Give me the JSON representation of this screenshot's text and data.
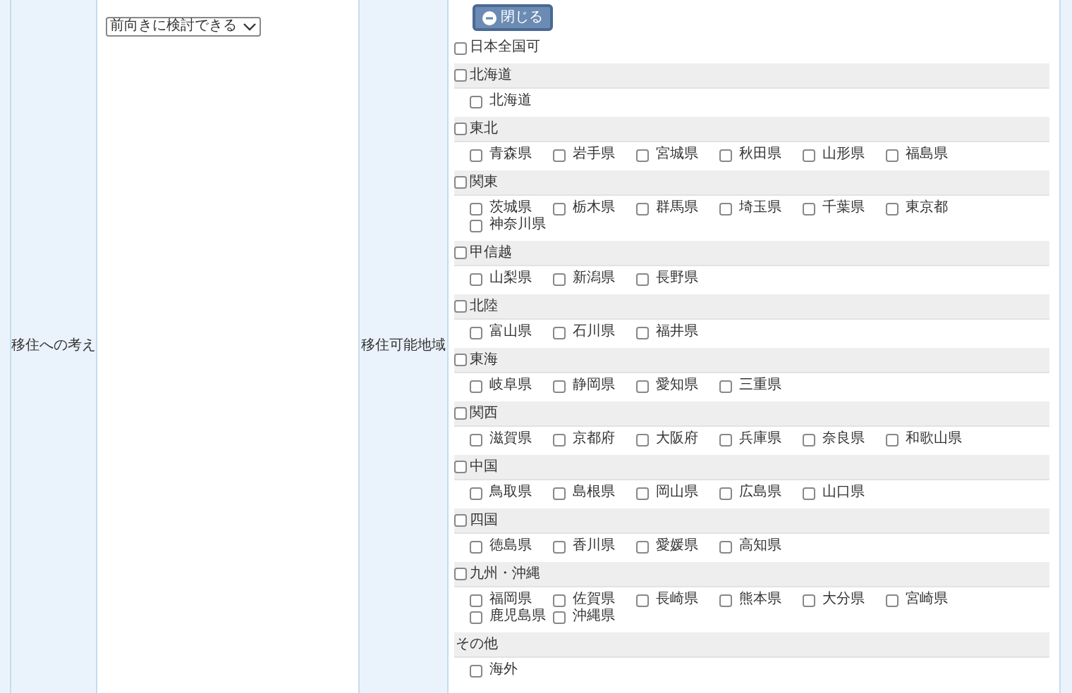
{
  "row": {
    "label_1": "移住への考え",
    "select": {
      "value": "前向きに検討できる"
    },
    "label_2": "移住可能地域"
  },
  "close_button": "閉じる",
  "all_japan": {
    "label": "日本全国可",
    "checked": false
  },
  "regions": [
    {
      "name": "北海道",
      "kind": "checkbox",
      "checked": false,
      "items": [
        {
          "label": "北海道",
          "checked": false
        }
      ]
    },
    {
      "name": "東北",
      "kind": "checkbox",
      "checked": false,
      "items": [
        {
          "label": "青森県",
          "checked": false
        },
        {
          "label": "岩手県",
          "checked": false
        },
        {
          "label": "宮城県",
          "checked": false
        },
        {
          "label": "秋田県",
          "checked": false
        },
        {
          "label": "山形県",
          "checked": false
        },
        {
          "label": "福島県",
          "checked": false
        }
      ]
    },
    {
      "name": "関東",
      "kind": "checkbox",
      "checked": false,
      "items": [
        {
          "label": "茨城県",
          "checked": false
        },
        {
          "label": "栃木県",
          "checked": false
        },
        {
          "label": "群馬県",
          "checked": false
        },
        {
          "label": "埼玉県",
          "checked": false
        },
        {
          "label": "千葉県",
          "checked": false
        },
        {
          "label": "東京都",
          "checked": false
        },
        {
          "label": "神奈川県",
          "checked": false
        }
      ]
    },
    {
      "name": "甲信越",
      "kind": "checkbox",
      "checked": false,
      "items": [
        {
          "label": "山梨県",
          "checked": false
        },
        {
          "label": "新潟県",
          "checked": false
        },
        {
          "label": "長野県",
          "checked": false
        }
      ]
    },
    {
      "name": "北陸",
      "kind": "checkbox",
      "checked": false,
      "items": [
        {
          "label": "富山県",
          "checked": false
        },
        {
          "label": "石川県",
          "checked": false
        },
        {
          "label": "福井県",
          "checked": false
        }
      ]
    },
    {
      "name": "東海",
      "kind": "checkbox",
      "checked": false,
      "items": [
        {
          "label": "岐阜県",
          "checked": false
        },
        {
          "label": "静岡県",
          "checked": false
        },
        {
          "label": "愛知県",
          "checked": false
        },
        {
          "label": "三重県",
          "checked": false
        }
      ]
    },
    {
      "name": "関西",
      "kind": "checkbox",
      "checked": false,
      "items": [
        {
          "label": "滋賀県",
          "checked": false
        },
        {
          "label": "京都府",
          "checked": false
        },
        {
          "label": "大阪府",
          "checked": false
        },
        {
          "label": "兵庫県",
          "checked": false
        },
        {
          "label": "奈良県",
          "checked": false
        },
        {
          "label": "和歌山県",
          "checked": false
        }
      ]
    },
    {
      "name": "中国",
      "kind": "checkbox",
      "checked": false,
      "items": [
        {
          "label": "鳥取県",
          "checked": false
        },
        {
          "label": "島根県",
          "checked": false
        },
        {
          "label": "岡山県",
          "checked": false
        },
        {
          "label": "広島県",
          "checked": false
        },
        {
          "label": "山口県",
          "checked": false
        }
      ]
    },
    {
      "name": "四国",
      "kind": "checkbox",
      "checked": false,
      "items": [
        {
          "label": "徳島県",
          "checked": false
        },
        {
          "label": "香川県",
          "checked": false
        },
        {
          "label": "愛媛県",
          "checked": false
        },
        {
          "label": "高知県",
          "checked": false
        }
      ]
    },
    {
      "name": "九州・沖縄",
      "kind": "checkbox",
      "checked": false,
      "items": [
        {
          "label": "福岡県",
          "checked": false
        },
        {
          "label": "佐賀県",
          "checked": false
        },
        {
          "label": "長崎県",
          "checked": false
        },
        {
          "label": "熊本県",
          "checked": false
        },
        {
          "label": "大分県",
          "checked": false
        },
        {
          "label": "宮崎県",
          "checked": false
        },
        {
          "label": "鹿児島県",
          "checked": false
        },
        {
          "label": "沖縄県",
          "checked": false
        }
      ]
    },
    {
      "name": "その他",
      "kind": "plain",
      "items": [
        {
          "label": "海外",
          "checked": false
        }
      ]
    }
  ]
}
